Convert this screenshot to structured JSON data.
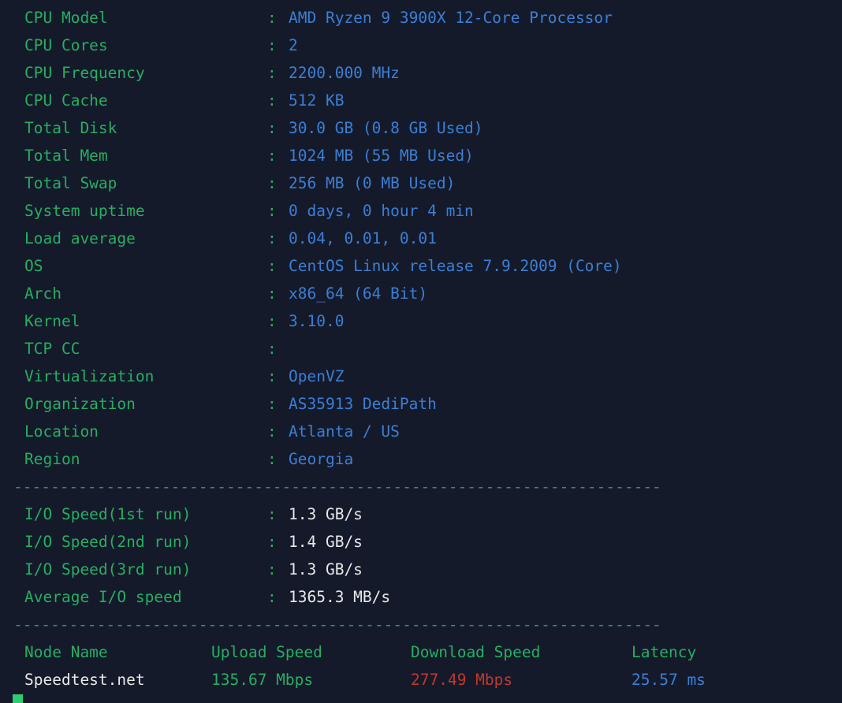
{
  "terminal": {
    "background_color": "#151a2b",
    "label_color": "#27ae60",
    "value_color": "#3b7fd4",
    "white_color": "#e8e8e8",
    "red_color": "#c0392b",
    "separator_color": "#2f8f6d",
    "cursor_color": "#2ecc71",
    "separator": "----------------------------------------------------------------------"
  },
  "system_info": [
    {
      "label": "CPU Model",
      "colon": ":",
      "value": "AMD Ryzen 9 3900X 12-Core Processor"
    },
    {
      "label": "CPU Cores",
      "colon": ":",
      "value": "2"
    },
    {
      "label": "CPU Frequency",
      "colon": ":",
      "value": "2200.000 MHz"
    },
    {
      "label": "CPU Cache",
      "colon": ":",
      "value": "512 KB"
    },
    {
      "label": "Total Disk",
      "colon": ":",
      "value": "30.0 GB (0.8 GB Used)"
    },
    {
      "label": "Total Mem",
      "colon": ":",
      "value": "1024 MB (55 MB Used)"
    },
    {
      "label": "Total Swap",
      "colon": ":",
      "value": "256 MB (0 MB Used)"
    },
    {
      "label": "System uptime",
      "colon": ":",
      "value": "0 days, 0 hour 4 min"
    },
    {
      "label": "Load average",
      "colon": ":",
      "value": "0.04, 0.01, 0.01"
    },
    {
      "label": "OS",
      "colon": ":",
      "value": "CentOS Linux release 7.9.2009 (Core)"
    },
    {
      "label": "Arch",
      "colon": ":",
      "value": "x86_64 (64 Bit)"
    },
    {
      "label": "Kernel",
      "colon": ":",
      "value": "3.10.0"
    },
    {
      "label": "TCP CC",
      "colon": ":",
      "value": ""
    },
    {
      "label": "Virtualization",
      "colon": ":",
      "value": "OpenVZ"
    },
    {
      "label": "Organization",
      "colon": ":",
      "value": "AS35913 DediPath"
    },
    {
      "label": "Location",
      "colon": ":",
      "value": "Atlanta / US"
    },
    {
      "label": "Region",
      "colon": ":",
      "value": "Georgia"
    }
  ],
  "io_speed": [
    {
      "label": "I/O Speed(1st run)",
      "colon": ":",
      "value": "1.3 GB/s"
    },
    {
      "label": "I/O Speed(2nd run)",
      "colon": ":",
      "value": "1.4 GB/s"
    },
    {
      "label": "I/O Speed(3rd run)",
      "colon": ":",
      "value": "1.3 GB/s"
    },
    {
      "label": "Average I/O speed",
      "colon": ":",
      "value": "1365.3 MB/s"
    }
  ],
  "speedtest": {
    "headers": {
      "node_name": "Node Name",
      "upload_speed": "Upload Speed",
      "download_speed": "Download Speed",
      "latency": "Latency"
    },
    "rows": [
      {
        "node_name": "Speedtest.net",
        "upload_speed": "135.67 Mbps",
        "download_speed": "277.49 Mbps",
        "latency": "25.57 ms"
      }
    ]
  }
}
